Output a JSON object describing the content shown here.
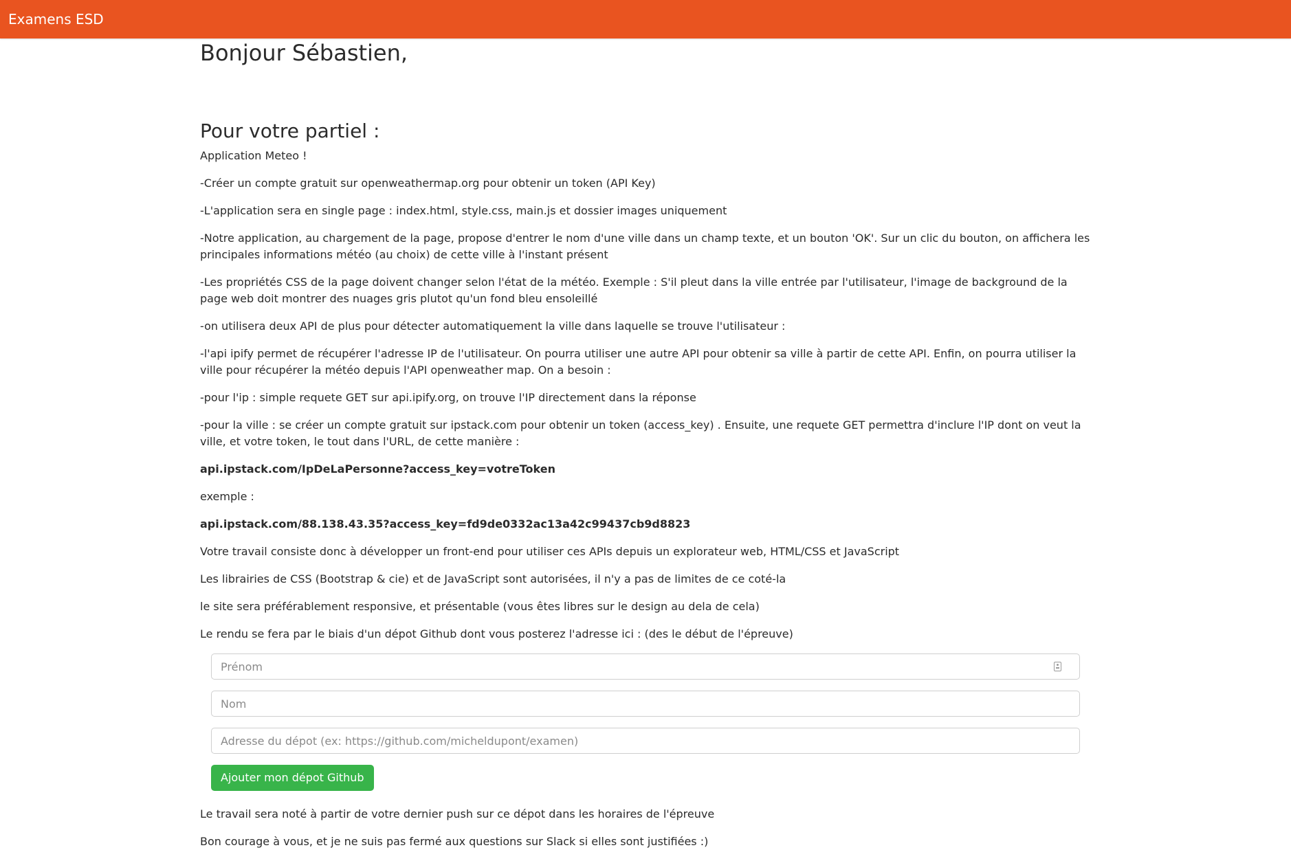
{
  "navbar": {
    "brand": "Examens ESD"
  },
  "greeting": "Bonjour Sébastien,",
  "subtitle": "Pour votre partiel :",
  "paragraphs_before": [
    {
      "text": "Application Meteo !",
      "bold": false
    },
    {
      "text": "-Créer un compte gratuit sur openweathermap.org pour obtenir un token (API Key)",
      "bold": false
    },
    {
      "text": "-L'application sera en single page : index.html, style.css, main.js et dossier images uniquement",
      "bold": false
    },
    {
      "text": "-Notre application, au chargement de la page, propose d'entrer le nom d'une ville dans un champ texte, et un bouton 'OK'. Sur un clic du bouton, on affichera les principales informations météo (au choix) de cette ville à l'instant présent",
      "bold": false
    },
    {
      "text": "-Les propriétés CSS de la page doivent changer selon l'état de la météo. Exemple : S'il pleut dans la ville entrée par l'utilisateur, l'image de background de la page web doit montrer des nuages gris plutot qu'un fond bleu ensoleillé",
      "bold": false
    },
    {
      "text": "-on utilisera deux API de plus pour détecter automatiquement la ville dans laquelle se trouve l'utilisateur :",
      "bold": false
    },
    {
      "text": "-l'api ipify permet de récupérer l'adresse IP de l'utilisateur. On pourra utiliser une autre API pour obtenir sa ville à partir de cette API. Enfin, on pourra utiliser la ville pour récupérer la météo depuis l'API openweather map. On a besoin :",
      "bold": false
    },
    {
      "text": "-pour l'ip : simple requete GET sur api.ipify.org, on trouve l'IP directement dans la réponse",
      "bold": false
    },
    {
      "text": "-pour la ville : se créer un compte gratuit sur ipstack.com pour obtenir un token (access_key) . Ensuite, une requete GET permettra d'inclure l'IP dont on veut la ville, et votre token, le tout dans l'URL, de cette manière :",
      "bold": false
    },
    {
      "text": "api.ipstack.com/IpDeLaPersonne?access_key=votreToken",
      "bold": true
    },
    {
      "text": "exemple :",
      "bold": false
    },
    {
      "text": "api.ipstack.com/88.138.43.35?access_key=fd9de0332ac13a42c99437cb9d8823",
      "bold": true
    },
    {
      "text": "Votre travail consiste donc à développer un front-end pour utiliser ces APIs depuis un explorateur web, HTML/CSS et JavaScript",
      "bold": false
    },
    {
      "text": "Les librairies de CSS (Bootstrap & cie) et de JavaScript sont autorisées, il n'y a pas de limites de ce coté-la",
      "bold": false
    },
    {
      "text": "le site sera préférablement responsive, et présentable (vous êtes libres sur le design au dela de cela)",
      "bold": false
    },
    {
      "text": "Le rendu se fera par le biais d'un dépot Github dont vous posterez l'adresse ici : (des le début de l'épreuve)",
      "bold": false
    }
  ],
  "form": {
    "firstname_placeholder": "Prénom",
    "firstname_value": "",
    "lastname_placeholder": "Nom",
    "lastname_value": "",
    "repo_placeholder": "Adresse du dépot (ex: https://github.com/micheldupont/examen)",
    "repo_value": "",
    "submit_label": "Ajouter mon dépot Github",
    "submit_color": "#38b44a"
  },
  "paragraphs_after": [
    "Le travail sera noté à partir de votre dernier push sur ce dépot dans les horaires de l'épreuve",
    "Bon courage à vous, et je ne suis pas fermé aux questions sur Slack si elles sont justifiées :)"
  ],
  "colors": {
    "navbar": "#e95420",
    "text": "#2b2b2b"
  }
}
